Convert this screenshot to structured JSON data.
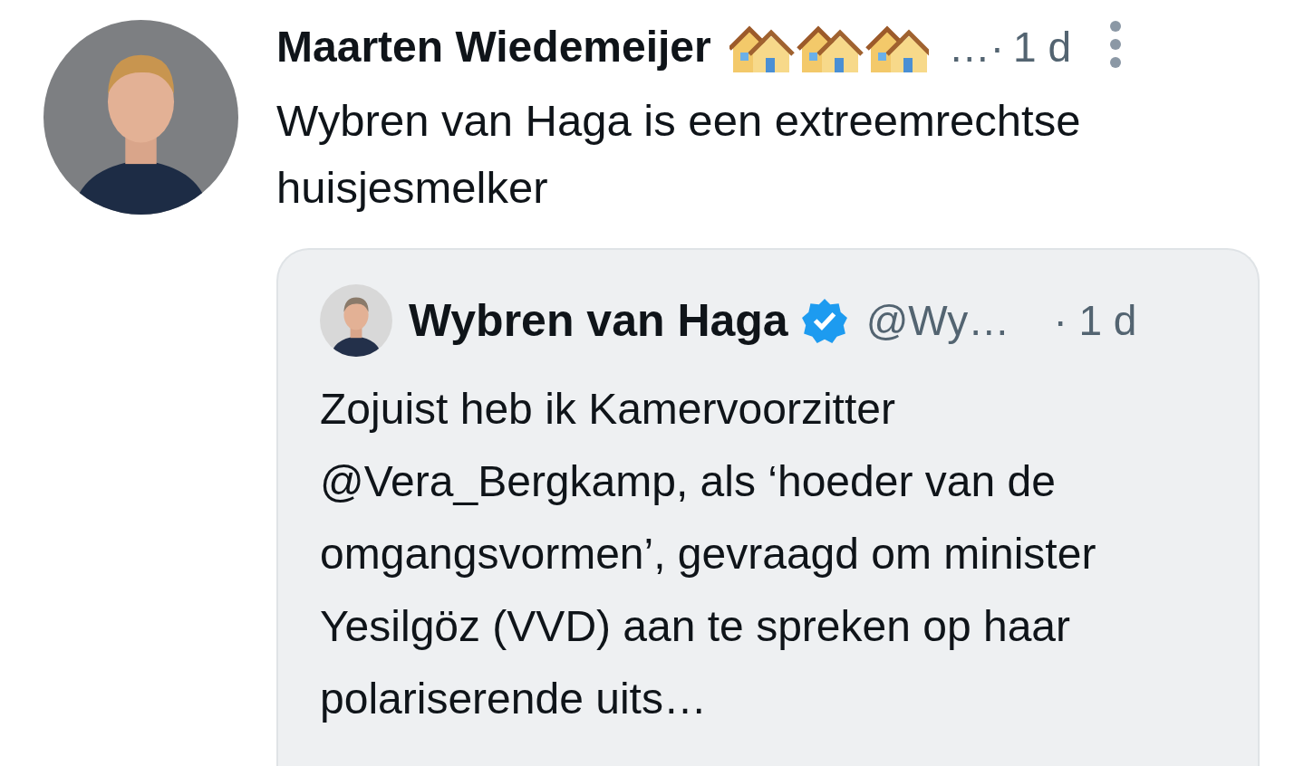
{
  "tweet": {
    "author": {
      "name": "Maarten Wiedemeijer",
      "more": "…·",
      "time": "1 d"
    },
    "text": "Wybren van Haga is een extreemrechtse huisjesmelker",
    "quote": {
      "author": {
        "name": "Wybren van Haga",
        "verified": true,
        "handle": "@Wy…",
        "time": "· 1 d"
      },
      "text": "Zojuist heb ik Kamervoorzitter @Vera_Bergkamp, als ‘hoeder van de omgangsvormen’, gevraagd om minister Yesilgöz (VVD) aan te spreken op haar polariserende uits…"
    }
  }
}
